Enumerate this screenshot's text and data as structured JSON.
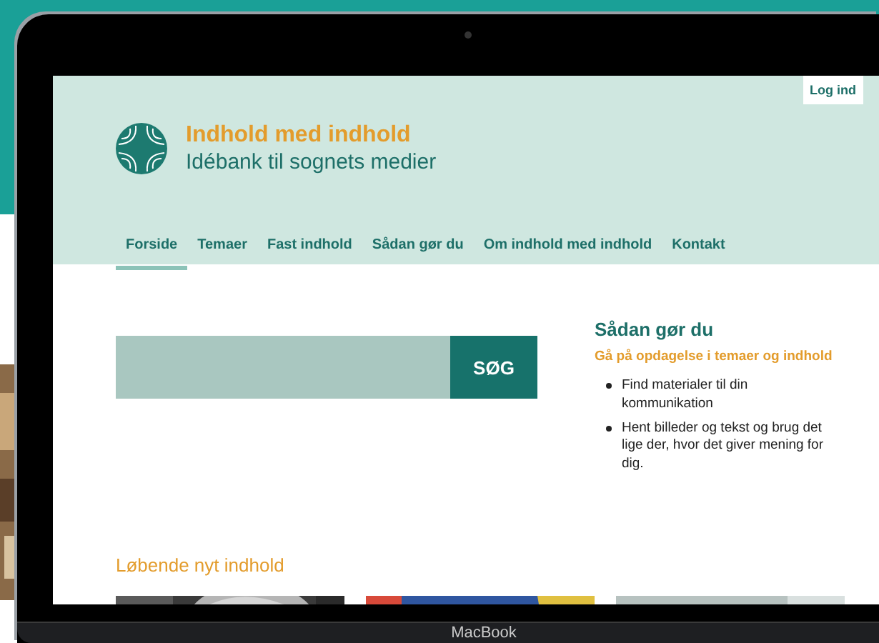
{
  "laptop": {
    "label": "MacBook"
  },
  "header": {
    "login": "Log ind",
    "title": "Indhold med indhold",
    "subtitle": "Idébank til sognets medier"
  },
  "nav": [
    {
      "label": "Forside",
      "selected": true
    },
    {
      "label": "Temaer",
      "selected": false
    },
    {
      "label": "Fast indhold",
      "selected": false
    },
    {
      "label": "Sådan gør du",
      "selected": false
    },
    {
      "label": "Om indhold med indhold",
      "selected": false
    },
    {
      "label": "Kontakt",
      "selected": false
    }
  ],
  "search": {
    "button": "SØG"
  },
  "aside": {
    "heading": "Sådan gør du",
    "subheading": "Gå på opdagelse i temaer og indhold",
    "bullets": [
      "Find materialer til din kommunikation",
      "Hent billeder og tekst og brug det lige der, hvor det giver mening for dig."
    ]
  },
  "section": {
    "title": "Løbende nyt indhold"
  }
}
